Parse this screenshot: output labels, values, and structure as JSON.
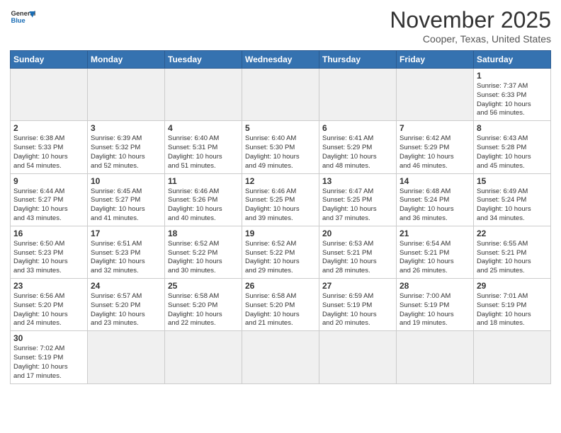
{
  "header": {
    "logo_general": "General",
    "logo_blue": "Blue",
    "month_title": "November 2025",
    "location": "Cooper, Texas, United States"
  },
  "weekdays": [
    "Sunday",
    "Monday",
    "Tuesday",
    "Wednesday",
    "Thursday",
    "Friday",
    "Saturday"
  ],
  "weeks": [
    [
      {
        "day": "",
        "info": ""
      },
      {
        "day": "",
        "info": ""
      },
      {
        "day": "",
        "info": ""
      },
      {
        "day": "",
        "info": ""
      },
      {
        "day": "",
        "info": ""
      },
      {
        "day": "",
        "info": ""
      },
      {
        "day": "1",
        "info": "Sunrise: 7:37 AM\nSunset: 6:33 PM\nDaylight: 10 hours\nand 56 minutes."
      }
    ],
    [
      {
        "day": "2",
        "info": "Sunrise: 6:38 AM\nSunset: 5:33 PM\nDaylight: 10 hours\nand 54 minutes."
      },
      {
        "day": "3",
        "info": "Sunrise: 6:39 AM\nSunset: 5:32 PM\nDaylight: 10 hours\nand 52 minutes."
      },
      {
        "day": "4",
        "info": "Sunrise: 6:40 AM\nSunset: 5:31 PM\nDaylight: 10 hours\nand 51 minutes."
      },
      {
        "day": "5",
        "info": "Sunrise: 6:40 AM\nSunset: 5:30 PM\nDaylight: 10 hours\nand 49 minutes."
      },
      {
        "day": "6",
        "info": "Sunrise: 6:41 AM\nSunset: 5:29 PM\nDaylight: 10 hours\nand 48 minutes."
      },
      {
        "day": "7",
        "info": "Sunrise: 6:42 AM\nSunset: 5:29 PM\nDaylight: 10 hours\nand 46 minutes."
      },
      {
        "day": "8",
        "info": "Sunrise: 6:43 AM\nSunset: 5:28 PM\nDaylight: 10 hours\nand 45 minutes."
      }
    ],
    [
      {
        "day": "9",
        "info": "Sunrise: 6:44 AM\nSunset: 5:27 PM\nDaylight: 10 hours\nand 43 minutes."
      },
      {
        "day": "10",
        "info": "Sunrise: 6:45 AM\nSunset: 5:27 PM\nDaylight: 10 hours\nand 41 minutes."
      },
      {
        "day": "11",
        "info": "Sunrise: 6:46 AM\nSunset: 5:26 PM\nDaylight: 10 hours\nand 40 minutes."
      },
      {
        "day": "12",
        "info": "Sunrise: 6:46 AM\nSunset: 5:25 PM\nDaylight: 10 hours\nand 39 minutes."
      },
      {
        "day": "13",
        "info": "Sunrise: 6:47 AM\nSunset: 5:25 PM\nDaylight: 10 hours\nand 37 minutes."
      },
      {
        "day": "14",
        "info": "Sunrise: 6:48 AM\nSunset: 5:24 PM\nDaylight: 10 hours\nand 36 minutes."
      },
      {
        "day": "15",
        "info": "Sunrise: 6:49 AM\nSunset: 5:24 PM\nDaylight: 10 hours\nand 34 minutes."
      }
    ],
    [
      {
        "day": "16",
        "info": "Sunrise: 6:50 AM\nSunset: 5:23 PM\nDaylight: 10 hours\nand 33 minutes."
      },
      {
        "day": "17",
        "info": "Sunrise: 6:51 AM\nSunset: 5:23 PM\nDaylight: 10 hours\nand 32 minutes."
      },
      {
        "day": "18",
        "info": "Sunrise: 6:52 AM\nSunset: 5:22 PM\nDaylight: 10 hours\nand 30 minutes."
      },
      {
        "day": "19",
        "info": "Sunrise: 6:52 AM\nSunset: 5:22 PM\nDaylight: 10 hours\nand 29 minutes."
      },
      {
        "day": "20",
        "info": "Sunrise: 6:53 AM\nSunset: 5:21 PM\nDaylight: 10 hours\nand 28 minutes."
      },
      {
        "day": "21",
        "info": "Sunrise: 6:54 AM\nSunset: 5:21 PM\nDaylight: 10 hours\nand 26 minutes."
      },
      {
        "day": "22",
        "info": "Sunrise: 6:55 AM\nSunset: 5:21 PM\nDaylight: 10 hours\nand 25 minutes."
      }
    ],
    [
      {
        "day": "23",
        "info": "Sunrise: 6:56 AM\nSunset: 5:20 PM\nDaylight: 10 hours\nand 24 minutes."
      },
      {
        "day": "24",
        "info": "Sunrise: 6:57 AM\nSunset: 5:20 PM\nDaylight: 10 hours\nand 23 minutes."
      },
      {
        "day": "25",
        "info": "Sunrise: 6:58 AM\nSunset: 5:20 PM\nDaylight: 10 hours\nand 22 minutes."
      },
      {
        "day": "26",
        "info": "Sunrise: 6:58 AM\nSunset: 5:20 PM\nDaylight: 10 hours\nand 21 minutes."
      },
      {
        "day": "27",
        "info": "Sunrise: 6:59 AM\nSunset: 5:19 PM\nDaylight: 10 hours\nand 20 minutes."
      },
      {
        "day": "28",
        "info": "Sunrise: 7:00 AM\nSunset: 5:19 PM\nDaylight: 10 hours\nand 19 minutes."
      },
      {
        "day": "29",
        "info": "Sunrise: 7:01 AM\nSunset: 5:19 PM\nDaylight: 10 hours\nand 18 minutes."
      }
    ],
    [
      {
        "day": "30",
        "info": "Sunrise: 7:02 AM\nSunset: 5:19 PM\nDaylight: 10 hours\nand 17 minutes."
      },
      {
        "day": "",
        "info": ""
      },
      {
        "day": "",
        "info": ""
      },
      {
        "day": "",
        "info": ""
      },
      {
        "day": "",
        "info": ""
      },
      {
        "day": "",
        "info": ""
      },
      {
        "day": "",
        "info": ""
      }
    ]
  ]
}
